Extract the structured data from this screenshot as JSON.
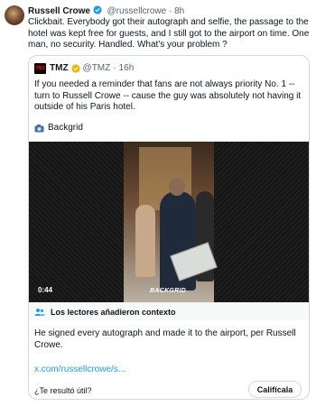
{
  "tweet": {
    "author_name": "Russell Crowe",
    "handle": "@russellcrowe",
    "separator": "·",
    "time": "8h",
    "text": "Clickbait. Everybody got their autograph and selfie, the passage to the hotel was kept free for guests, and I still got to the airport on time. One man, no security. Handled. What's your problem ?"
  },
  "quoted": {
    "logo_text": "TMZ",
    "author_name": "TMZ",
    "handle": "@TMZ",
    "separator": "·",
    "time": "16h",
    "text": "If you needed a reminder that fans are not always priority No. 1 -- turn to Russell Crowe -- cause the guy was absolutely not having it outside of his Paris hotel.",
    "credit": "Backgrid",
    "credit_icon": "camera-icon",
    "video": {
      "duration": "0:44",
      "watermark": "BACKGRID"
    }
  },
  "community_note": {
    "header": "Los lectores añadieron contexto",
    "body": "He signed every autograph and made it to the airport, per Russell Crowe.",
    "link": "x.com/russellcrowe/s...",
    "question": "¿Te resultó útil?",
    "rate_label": "Califícala"
  },
  "colors": {
    "link": "#1d9bf0",
    "verified": "#f4b400",
    "muted": "#536471"
  }
}
